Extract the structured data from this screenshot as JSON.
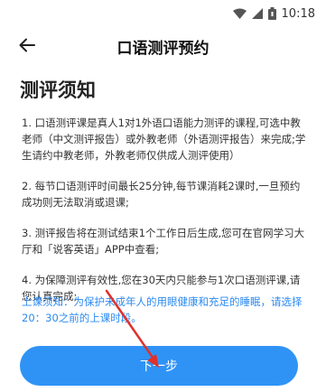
{
  "status_bar": {
    "time": "10:18",
    "icons": [
      "wifi-icon",
      "signal-icon",
      "battery-icon"
    ]
  },
  "app_bar": {
    "title": "口语测评预约",
    "back_icon": "back-arrow-icon"
  },
  "section": {
    "title": "测评须知"
  },
  "rules": [
    "1. 口语测评课是真人1对1外语口语能力测评的课程,可选中教老师（中文测评报告）或外教老师（外语测评报告）来完成;学生请约中教老师，外教老师仅供成人测评使用）",
    "2. 每节口语测评时间最长25分钟,每节课消耗2课时,一旦预约成功则无法取消或退课;",
    "3. 测评报告将在测试结束1个工作日后生成,您可在官网学习大厅和「说客英语」APP中查看;",
    "4. 为保障测评有效性,您在30天内只能参与1次口语测评课,请您认真完成;"
  ],
  "notice": "上课须知：为保护未成年人的用眼健康和充足的睡眠，请选择20：30之前的上课时段。",
  "next_button": {
    "label": "下一步"
  },
  "colors": {
    "accent": "#2f93f5",
    "notice_text": "#2b8af1",
    "annotation_arrow": "#e0312b"
  }
}
